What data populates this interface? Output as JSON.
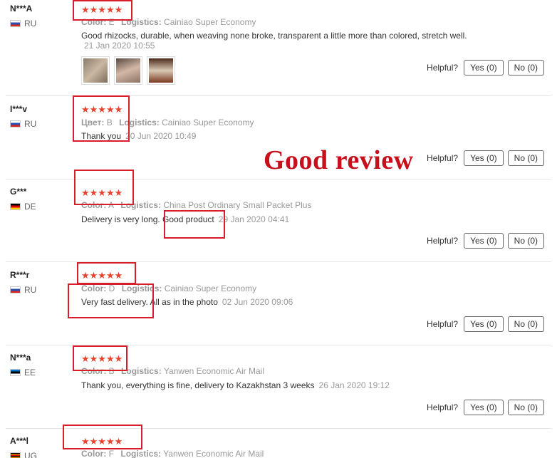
{
  "overlay_title": "Good review",
  "helpful_label": "Helpful?",
  "yes_label": "Yes (0)",
  "no_label": "No (0)",
  "stars": "★★★★★",
  "logistics_key": "Logistics:",
  "reviews": [
    {
      "buyer": "N***A",
      "country": "RU",
      "color_key": "Color:",
      "color_val": "E",
      "logistics": "Cainiao Super Economy",
      "text": "Good rhizocks, durable, when weaving none broke, transparent a little more than colored, stretch well.",
      "date": "21 Jan 2020 10:55"
    },
    {
      "buyer": "I***v",
      "country": "RU",
      "color_key": "Цвет:",
      "color_val": "B",
      "logistics": "Cainiao Super Economy",
      "text": "Thank you",
      "date": "20 Jun 2020 10:49"
    },
    {
      "buyer": "G***",
      "country": "DE",
      "color_key": "Color:",
      "color_val": "A",
      "logistics": "China Post Ordinary Small Packet Plus",
      "text_a": "Delivery is very long.",
      "text_b": "Good product",
      "date": "29 Jan 2020 04:41"
    },
    {
      "buyer": "R***r",
      "country": "RU",
      "color_key": "Color:",
      "color_val": "D",
      "logistics": "Cainiao Super Economy",
      "text": "Very fast delivery. All as in the photo",
      "date": "02 Jun 2020 09:06"
    },
    {
      "buyer": "N***a",
      "country": "EE",
      "color_key": "Color:",
      "color_val": "B",
      "logistics": "Yanwen Economic Air Mail",
      "text": "Thank you, everything is fine, delivery to Kazakhstan 3 weeks",
      "date": "26 Jan 2020 19:12"
    },
    {
      "buyer": "A***l",
      "country": "UG",
      "color_key": "Color:",
      "color_val": "F",
      "logistics": "Yanwen Economic Air Mail"
    }
  ],
  "colors": {
    "star": "#e8432e",
    "highlight_box": "#d81e2a",
    "overlay_text": "#c8101c"
  }
}
